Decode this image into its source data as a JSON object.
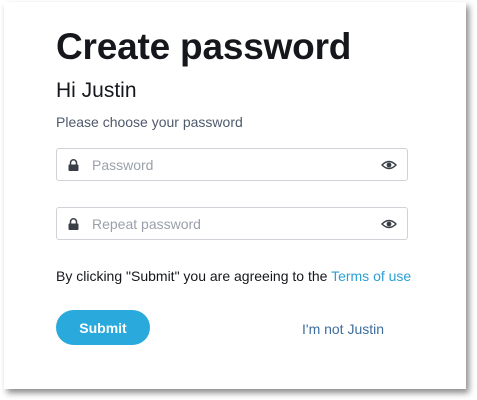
{
  "form": {
    "title": "Create password",
    "greeting": "Hi Justin",
    "instruction": "Please choose your password"
  },
  "fields": {
    "password": {
      "placeholder": "Password",
      "value": "",
      "left_icon": "lock-icon",
      "right_icon": "eye-icon"
    },
    "repeat_password": {
      "placeholder": "Repeat password",
      "value": "",
      "left_icon": "lock-icon",
      "right_icon": "eye-icon"
    }
  },
  "terms": {
    "text": "By clicking \"Submit\" you are agreeing to the ",
    "link_label": "Terms of use"
  },
  "actions": {
    "submit_label": "Submit",
    "not_user_label": "I'm not Justin"
  },
  "colors": {
    "accent": "#2aa9dc",
    "link": "#2a9fd6",
    "secondary_link": "#3d6e9e",
    "heading": "#15171c",
    "muted_text": "#4e5a6b",
    "border": "#cfd3d8"
  }
}
